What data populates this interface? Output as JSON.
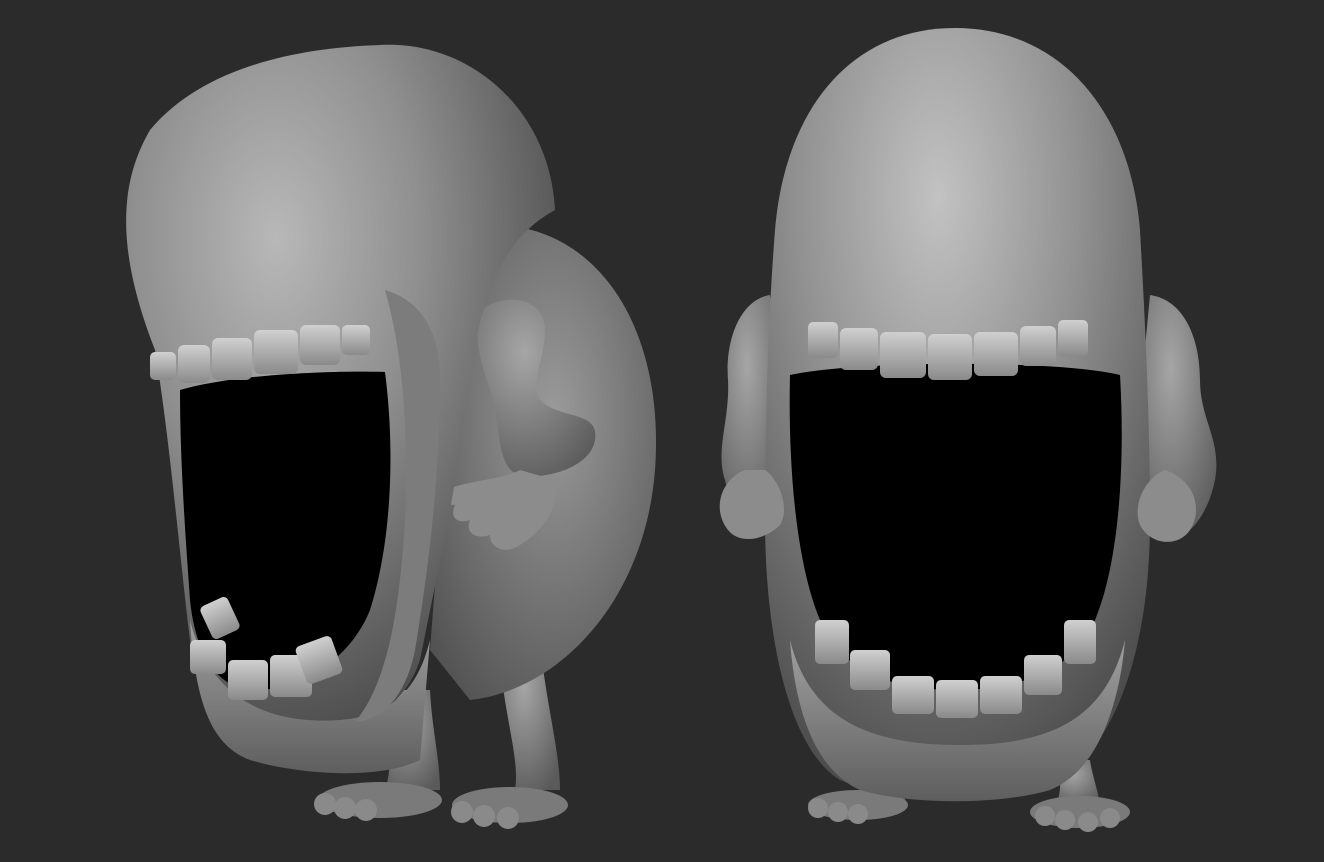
{
  "scene": {
    "background_color": "#2b2b2b",
    "clay_color": "#8e8e8e",
    "mouth_color": "#000000",
    "teeth_color": "#c4c4c4",
    "figures": [
      {
        "view": "three-quarter"
      },
      {
        "view": "front"
      }
    ]
  }
}
